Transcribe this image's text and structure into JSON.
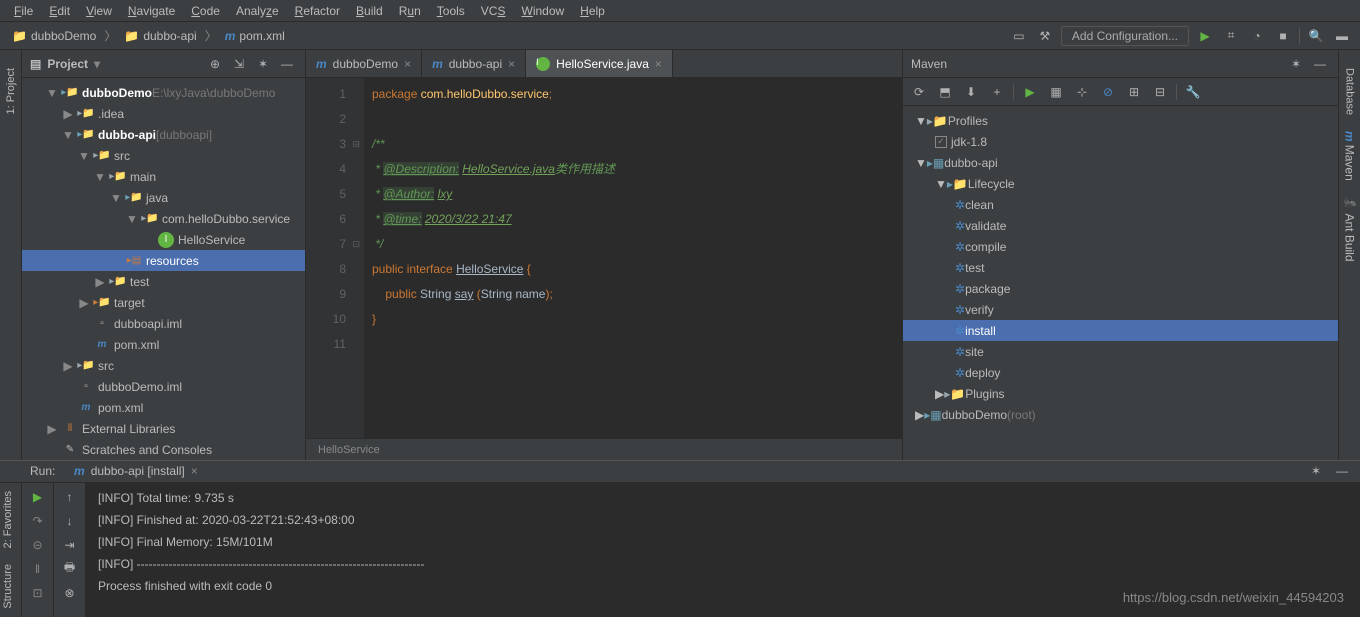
{
  "menu": [
    "File",
    "Edit",
    "View",
    "Navigate",
    "Code",
    "Analyze",
    "Refactor",
    "Build",
    "Run",
    "Tools",
    "VCS",
    "Window",
    "Help"
  ],
  "breadcrumb": [
    {
      "icon": "folder",
      "label": "dubboDemo"
    },
    {
      "icon": "folder",
      "label": "dubbo-api"
    },
    {
      "icon": "m",
      "label": "pom.xml"
    }
  ],
  "config_label": "Add Configuration...",
  "project": {
    "title": "Project",
    "root": {
      "label": "dubboDemo",
      "path": "E:\\lxyJava\\dubboDemo"
    },
    "tree": [
      {
        "indent": 1,
        "arrow": "▼",
        "icon": "folder-blue",
        "label": "dubboDemo",
        "suffix": " E:\\lxyJava\\dubboDemo",
        "bold": true
      },
      {
        "indent": 2,
        "arrow": "▶",
        "icon": "folder",
        "label": ".idea"
      },
      {
        "indent": 2,
        "arrow": "▼",
        "icon": "folder-blue",
        "label": "dubbo-api",
        "suffix": " [dubboapi]",
        "bold": true
      },
      {
        "indent": 3,
        "arrow": "▼",
        "icon": "folder",
        "label": "src"
      },
      {
        "indent": 4,
        "arrow": "▼",
        "icon": "folder",
        "label": "main"
      },
      {
        "indent": 5,
        "arrow": "▼",
        "icon": "folder-blue",
        "label": "java"
      },
      {
        "indent": 6,
        "arrow": "▼",
        "icon": "folder",
        "label": "com.helloDubbo.service"
      },
      {
        "indent": 7,
        "arrow": "",
        "icon": "interface",
        "label": "HelloService"
      },
      {
        "indent": 5,
        "arrow": "",
        "icon": "folder-res",
        "label": "resources",
        "selected": true
      },
      {
        "indent": 4,
        "arrow": "▶",
        "icon": "folder",
        "label": "test"
      },
      {
        "indent": 3,
        "arrow": "▶",
        "icon": "folder-orange",
        "label": "target"
      },
      {
        "indent": 3,
        "arrow": "",
        "icon": "file",
        "label": "dubboapi.iml"
      },
      {
        "indent": 3,
        "arrow": "",
        "icon": "m",
        "label": "pom.xml"
      },
      {
        "indent": 2,
        "arrow": "▶",
        "icon": "folder",
        "label": "src"
      },
      {
        "indent": 2,
        "arrow": "",
        "icon": "file",
        "label": "dubboDemo.iml"
      },
      {
        "indent": 2,
        "arrow": "",
        "icon": "m",
        "label": "pom.xml"
      },
      {
        "indent": 1,
        "arrow": "▶",
        "icon": "lib",
        "label": "External Libraries"
      },
      {
        "indent": 1,
        "arrow": "",
        "icon": "scratch",
        "label": "Scratches and Consoles"
      }
    ]
  },
  "tabs": [
    {
      "icon": "m",
      "label": "dubboDemo",
      "active": false
    },
    {
      "icon": "m",
      "label": "dubbo-api",
      "active": false
    },
    {
      "icon": "interface",
      "label": "HelloService.java",
      "active": true
    }
  ],
  "code": {
    "lines": [
      1,
      2,
      3,
      4,
      5,
      6,
      7,
      8,
      9,
      10,
      11
    ],
    "text": "package com.helloDubbo.service;\n\n/**\n * @Description: HelloService.java类作用描述\n * @Author: lxy\n * @time: 2020/3/22 21:47\n */\npublic interface HelloService {\n    public String say (String name);\n}\n"
  },
  "editor_breadcrumb": "HelloService",
  "maven": {
    "title": "Maven",
    "tree": [
      {
        "indent": 0,
        "arrow": "▼",
        "icon": "folder",
        "label": "Profiles"
      },
      {
        "indent": 1,
        "arrow": "",
        "icon": "check",
        "label": "jdk-1.8"
      },
      {
        "indent": 0,
        "arrow": "▼",
        "icon": "module",
        "label": "dubbo-api"
      },
      {
        "indent": 1,
        "arrow": "▼",
        "icon": "folder-cycle",
        "label": "Lifecycle"
      },
      {
        "indent": 2,
        "arrow": "",
        "icon": "gear",
        "label": "clean"
      },
      {
        "indent": 2,
        "arrow": "",
        "icon": "gear",
        "label": "validate"
      },
      {
        "indent": 2,
        "arrow": "",
        "icon": "gear",
        "label": "compile"
      },
      {
        "indent": 2,
        "arrow": "",
        "icon": "gear",
        "label": "test"
      },
      {
        "indent": 2,
        "arrow": "",
        "icon": "gear",
        "label": "package"
      },
      {
        "indent": 2,
        "arrow": "",
        "icon": "gear",
        "label": "verify"
      },
      {
        "indent": 2,
        "arrow": "",
        "icon": "gear",
        "label": "install",
        "selected": true
      },
      {
        "indent": 2,
        "arrow": "",
        "icon": "gear",
        "label": "site"
      },
      {
        "indent": 2,
        "arrow": "",
        "icon": "gear",
        "label": "deploy"
      },
      {
        "indent": 1,
        "arrow": "▶",
        "icon": "folder",
        "label": "Plugins"
      },
      {
        "indent": 0,
        "arrow": "▶",
        "icon": "module",
        "label": "dubboDemo",
        "suffix": " (root)"
      }
    ]
  },
  "run": {
    "title": "Run:",
    "tab": "dubbo-api [install]",
    "lines": [
      "[INFO] Total time: 9.735 s",
      "[INFO] Finished at: 2020-03-22T21:52:43+08:00",
      "[INFO] Final Memory: 15M/101M",
      "[INFO] ------------------------------------------------------------------------",
      "",
      "Process finished with exit code 0"
    ]
  },
  "left_tabs": [
    "1: Project"
  ],
  "left_tabs2": [
    "2: Favorites",
    "Structure"
  ],
  "right_tabs": [
    "Database",
    "Maven",
    "Ant Build"
  ],
  "watermark": "https://blog.csdn.net/weixin_44594203"
}
